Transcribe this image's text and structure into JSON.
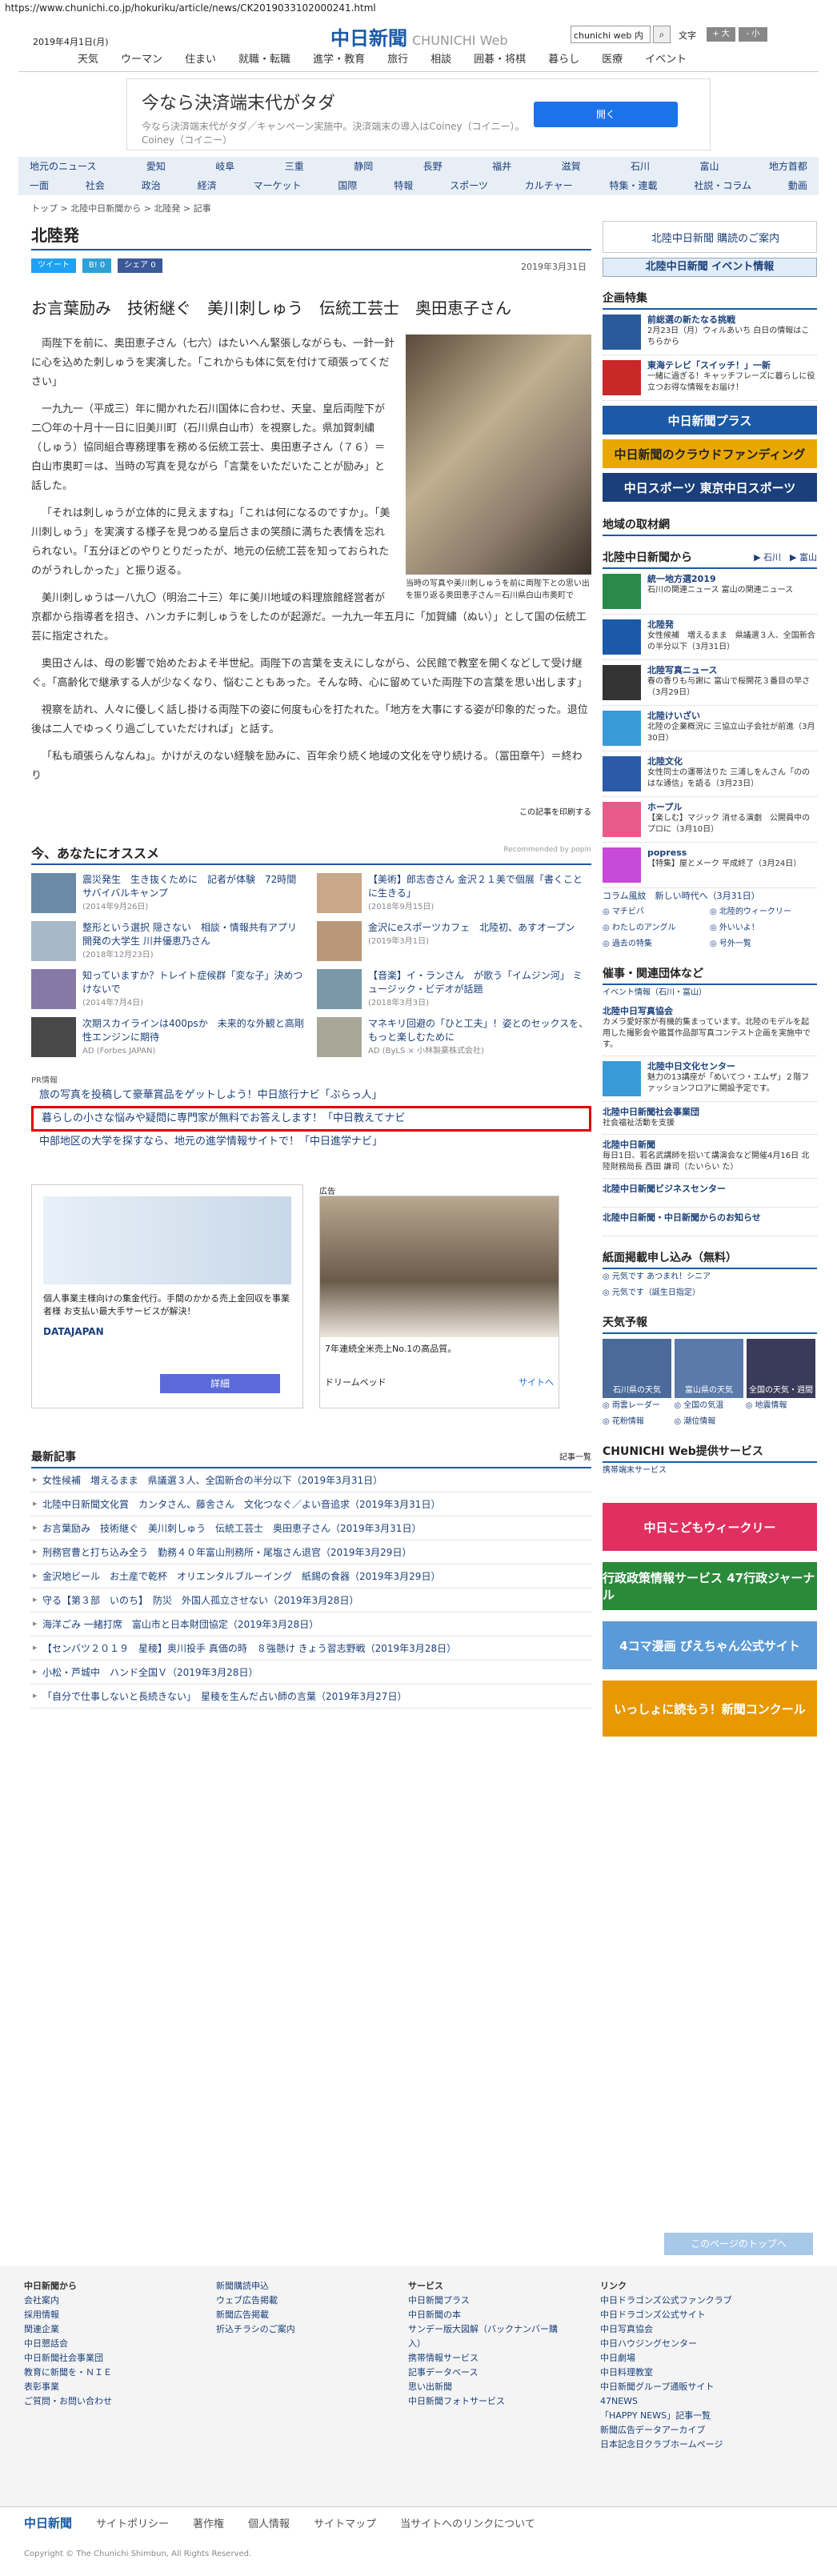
{
  "url": "https://www.chunichi.co.jp/hokuriku/article/news/CK2019033102000241.html",
  "header": {
    "date": "2019年4月1日(月)",
    "logo": "中日新聞",
    "logo_web": "CHUNICHI Web",
    "search_value": "chunichi web 内",
    "font_label": "文字",
    "font_large": "+ 大",
    "font_small": "- 小"
  },
  "topnav": [
    "天気",
    "ウーマン",
    "住まい",
    "就職・転職",
    "進学・教育",
    "旅行",
    "相談",
    "囲碁・将棋",
    "暮らし",
    "医療",
    "イベント"
  ],
  "ad_top": {
    "title": "今なら決済端末代がタダ",
    "sub": "今なら決済端末代がタダ／キャンペーン実施中。決済端末の導入はCoiney（コイニー）。Coiney（コイニー）",
    "button": "開く"
  },
  "nav2": {
    "row1": [
      "地元のニュース",
      "愛知",
      "岐阜",
      "三重",
      "静岡",
      "長野",
      "福井",
      "滋賀",
      "石川",
      "富山",
      "地方首都"
    ],
    "row2": [
      "一面",
      "社会",
      "政治",
      "経済",
      "マーケット",
      "国際",
      "特報",
      "スポーツ",
      "カルチャー",
      "特集・連載",
      "社説・コラム",
      "動画"
    ]
  },
  "breadcrumb": "トップ > 北陸中日新聞から > 北陸発 > 記事",
  "section_title": "北陸発",
  "share": {
    "tweet": "ツイート",
    "b": "B! 0",
    "f": "シェア 0",
    "date": "2019年3月31日"
  },
  "article": {
    "headline": "お言葉励み　技術継ぐ　美川刺しゅう　伝統工芸士　奥田恵子さん",
    "caption": "当時の写真や美川刺しゅうを前に両陛下との思い出を振り返る奥田恵子さん＝石川県白山市奥町で",
    "paras": [
      "両陛下を前に、奥田恵子さん（七六）はたいへん緊張しながらも、一針一針に心を込めた刺しゅうを実演した。「これからも体に気を付けて頑張ってください」",
      "一九九一（平成三）年に開かれた石川国体に合わせ、天皇、皇后両陛下が二〇年の十月十一日に旧美川町（石川県白山市）を視察した。県加賀刺繍（しゅう）協同組合専務理事を務める伝統工芸士、奥田恵子さん（７６）＝白山市奥町＝は、当時の写真を見ながら「言葉をいただいたことが励み」と話した。",
      "「それは刺しゅうが立体的に見えますね」「これは何になるのですか」。「美川刺しゅう」を実演する様子を見つめる皇后さまの笑顔に満ちた表情を忘れられない。「五分ほどのやりとりだったが、地元の伝統工芸を知っておられたのがうれしかった」と振り返る。",
      "美川刺しゅうは一八九〇（明治二十三）年に美川地域の料理旅館経営者が京都から指導者を招き、ハンカチに刺しゅうをしたのが起源だ。一九九一年五月に「加賀繡（ぬい）」として国の伝統工芸に指定された。",
      "奥田さんは、母の影響で始めたおよそ半世紀。両陛下の言葉を支えにしながら、公民館で教室を開くなどして受け継ぐ。「高齢化で継承する人が少なくなり、悩むこともあった。そんな時、心に留めていた両陛下の言葉を思い出します」",
      "視察を訪れ、人々に優しく話し掛ける両陛下の姿に何度も心を打たれた。「地方を大事にする姿が印象的だった。退位後は二人でゆっくり過ごしていただければ」と話す。",
      "「私も頑張らんなんね」。かけがえのない経験を励みに、百年余り続く地域の文化を守り続ける。（冨田章午）＝終わり"
    ],
    "print": "この記事を印刷する"
  },
  "recommend": {
    "title": "今、あなたにオススメ",
    "by": "Recommended by popIn",
    "items": [
      {
        "t": "震災発生　生き抜くために　記者が体験　72時間サバイバルキャンプ",
        "d": "(2014年9月26日)"
      },
      {
        "t": "【美術】郎志杏さん 金沢２１美で個展「書くことに生きる」",
        "d": "(2018年9月15日)"
      },
      {
        "t": "整形という選択 隠さない　相談・情報共有アプリ開発の大学生 川井優恵乃さん",
        "d": "(2018年12月23日)"
      },
      {
        "t": "金沢にeスポーツカフェ　北陸初、あすオープン",
        "d": "(2019年3月1日)"
      },
      {
        "t": "知っていますか？トレイト症候群「変な子」決めつけないで",
        "d": "(2014年7月4日)"
      },
      {
        "t": "【音楽】イ・ランさん　が歌う「イムジン河」 ミュージック・ビデオが話題",
        "d": "(2018年3月3日)"
      },
      {
        "t": "次期スカイラインは400psか　未来的な外観と高剛性エンジンに期待",
        "d": "AD (Forbes JAPAN)"
      },
      {
        "t": "マネキリ回避の「ひと工夫」！姿とのセックスを、もっと楽しむために",
        "d": "AD (ByLS × 小林製薬株式会社)"
      }
    ]
  },
  "pr": {
    "label": "PR情報",
    "links": [
      "旅の写真を投稿して豪華賞品をゲットしよう！中日旅行ナビ「ぶらっ人」",
      "暮らしの小さな悩みや疑問に専門家が無料でお答えします！「中日教えてナビ",
      "中部地区の大学を探すなら、地元の進学情報サイトで！「中日進学ナビ」"
    ]
  },
  "ads2": {
    "datajapan_text": "個人事業主様向けの集金代行。手間のかかる売上金回収を事業者様 お支払い最大手サービスが解決！",
    "datajapan_btn": "詳細",
    "kokoku": "広告",
    "bed_text": "7年連続全米売上No.1の高品質。",
    "dream": "ドリームベッド",
    "site": "サイトへ"
  },
  "recent": {
    "title": "最新記事",
    "more": "記事一覧",
    "items": [
      "女性候補　増えるまま　県議選３人、全国新合の半分以下（2019年3月31日）",
      "北陸中日新聞文化賞　カンタさん、藤舎さん　文化つなぐ／よい音追求（2019年3月31日）",
      "お言葉励み　技術継ぐ　美川刺しゅう　伝統工芸士　奥田恵子さん（2019年3月31日）",
      "刑務官曹と打ち込み全う　勤務４０年富山刑務所・尾塩さん退官（2019年3月29日）",
      "金沢地ビール　お土産で乾杯　オリエンタルブルーイング　紙錫の食器（2019年3月29日）",
      "守る【第３部　いのち】　防災　外国人孤立させない（2019年3月28日）",
      "海洋ごみ 一緒打席　富山市と日本財団協定（2019年3月28日）",
      "【センバツ２０１９　星稜】奥川投手 真価の時　８強懸け きょう習志野戦（2019年3月28日）",
      "小松・芦城中　ハンド全国Ｖ（2019年3月28日）",
      "「自分で仕事しないと長続きない」　星稜を生んだ占い師の言葉（2019年3月27日）"
    ]
  },
  "side": {
    "box1": "北陸中日新聞 購読のご案内",
    "box2": "北陸中日新聞 イベント情報",
    "feature_title": "企画特集",
    "features": [
      {
        "t": "前総選の新たなる挑戦",
        "s": "2月23日（月）ウィルあいち 白日の情報はこちらから"
      },
      {
        "t": "東海テレビ「スイッチ！」一新",
        "s": "一緒に過ぎる！キャッチフレーズに暮らしに役立つお得な情報をお届け！"
      }
    ],
    "banners": [
      "中日新聞プラス",
      "中日新聞のクラウドファンディング",
      "中日スポーツ 東京中日スポーツ"
    ],
    "local": "地域の取材網",
    "from_title": "北陸中日新聞から",
    "from_sub": "▶ 石川　▶ 富山",
    "from": [
      {
        "t": "統一地方選2019",
        "s": "石川の関連ニュース 富山の関連ニュース"
      },
      {
        "t": "北陸発",
        "s": "女性候補　増えるまま　県議選３人、全国新合の半分以下（3月31日）"
      },
      {
        "t": "北陸写真ニュース",
        "s": "春の香りも与謝に 富山で桜開花３番目の早さ（3月29日）"
      },
      {
        "t": "北陸けいざい",
        "s": "北陸の企業概況に 三協立山子会社が前進（3月30日）"
      },
      {
        "t": "北陸文化",
        "s": "女性同士の運帯法りた 三浦しをんさん「ののはな通信」を語る（3月23日）"
      },
      {
        "t": "ホープル",
        "s": "【楽しむ】マジック 消せる演劇　公開員中のプロに（3月10日）"
      },
      {
        "t": "popress",
        "s": "【特集】屋とメーク 平成終了（3月24日）"
      }
    ],
    "column": "コラム風紋　新しい時代へ（3月31日）",
    "links": [
      "マチビバ",
      "北陸的ウィークリー",
      "わたしのアングル",
      "外いいよ！",
      "過去の特集",
      "号外一覧"
    ],
    "saiji": "催事・関連団体など",
    "event": "イベント情報（石川・富山）",
    "orgs": [
      {
        "t": "北陸中日写真協会",
        "s": "カメラ愛好家が有機的集まっています。北陸のモデルを起用した撮影会や鑑賞作品部写真コンテスト企画を実施中です。"
      },
      {
        "t": "北陸中日文化センター",
        "s": "魅力の13講座が「めいてつ・エムザ」２階ファッションフロアに開設予定です。"
      },
      {
        "t": "北陸中日新聞社会事業団",
        "s": "社会福祉活動を支援"
      },
      {
        "t": "北陸中日新聞",
        "s": "毎日1日、若名武講師を招いて講演会など開催4月16日 北陸財務局長 西田 謙司（たいらい た）"
      },
      {
        "t": "北陸中日新聞ビジネスセンター",
        "s": ""
      },
      {
        "t": "北陸中日新聞・中日新聞からのお知らせ",
        "s": ""
      }
    ],
    "koukoku": "紙面掲載申し込み（無料）",
    "koukoku_links": [
      "元気です あつまれ！シニア",
      "元気です（誕生日指定）"
    ],
    "tenki": "天気予報",
    "weather": [
      "石川県の天気",
      "富山県の天気",
      "全国の天気・週間"
    ],
    "weather_links": [
      "雨雲レーダー",
      "全国の気温",
      "地震情報",
      "花粉情報",
      "潮位情報"
    ],
    "service": "CHUNICHI Web提供サービス",
    "service_link": "携帯端末サービス",
    "banners2": [
      "中日こどもウィークリー",
      "行政政策情報サービス 47行政ジャーナル",
      "4コマ漫画 ぴえちゃん公式サイト",
      "いっしょに読もう！新聞コンクール"
    ]
  },
  "pagetop": "このページのトップへ",
  "footer": {
    "cols": [
      {
        "h": "中日新聞から",
        "l": [
          "会社案内",
          "採用情報",
          "関連企業",
          "中日懇話会",
          "中日新聞社会事業団",
          "教育に新聞を・ＮＩＥ",
          "表彰事業",
          "ご質問・お問い合わせ"
        ]
      },
      {
        "h": "",
        "l": [
          "新聞購読申込",
          "ウェブ広告掲載",
          "新聞広告掲載",
          "折込チラシのご案内"
        ]
      },
      {
        "h": "サービス",
        "l": [
          "中日新聞プラス",
          "中日新聞の本",
          "サンデー版大図解（バックナンバー購入）",
          "携帯情報サービス",
          "記事データベース",
          "思い出新聞",
          "中日新聞フォトサービス"
        ]
      },
      {
        "h": "リンク",
        "l": [
          "中日ドラゴンズ公式ファンクラブ",
          "中日ドラゴンズ公式サイト",
          "中日写真協会",
          "中日ハウジングセンター",
          "中日劇場",
          "中日料理教室",
          "中日新聞グループ通販サイト",
          "47NEWS",
          "「HAPPY NEWS」記事一覧",
          "新聞広告データアーカイブ",
          "日本記念日クラブホームページ"
        ]
      }
    ],
    "bar": [
      "中日新聞",
      "サイトポリシー",
      "著作権",
      "個人情報",
      "サイトマップ",
      "当サイトへのリンクについて"
    ],
    "copy": "Copyright © The Chunichi Shimbun, All Rights Reserved."
  }
}
